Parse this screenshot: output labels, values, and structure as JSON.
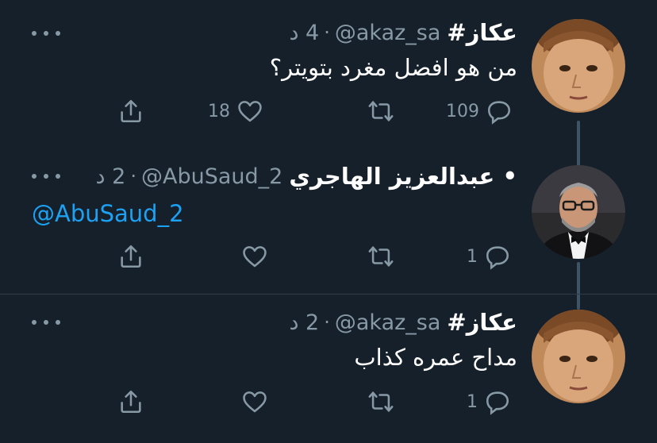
{
  "tweets": [
    {
      "name": "#عكاز",
      "handle": "@akaz_sa",
      "time": "4 د",
      "text": "من هو افضل مغرد بتويتر؟",
      "replies": "109",
      "retweets": "",
      "likes": "18",
      "avatar": "boy-avatar"
    },
    {
      "name": "عبدالعزيز الهاجري •",
      "handle": "@AbuSaud_2",
      "time": "2 د",
      "text": "@AbuSaud_2",
      "replies": "1",
      "retweets": "",
      "likes": "",
      "avatar": "man-in-tuxedo-avatar"
    },
    {
      "name": "#عكاز",
      "handle": "@akaz_sa",
      "time": "2 د",
      "text": "مداح عمره كذاب",
      "replies": "1",
      "retweets": "",
      "likes": "",
      "avatar": "boy-avatar"
    }
  ],
  "colors": {
    "background": "#15202b",
    "muted": "#8899a6",
    "link": "#1da1f2",
    "thread": "#3d5466"
  },
  "icons": [
    "reply-icon",
    "retweet-icon",
    "like-icon",
    "share-icon",
    "more-icon"
  ]
}
